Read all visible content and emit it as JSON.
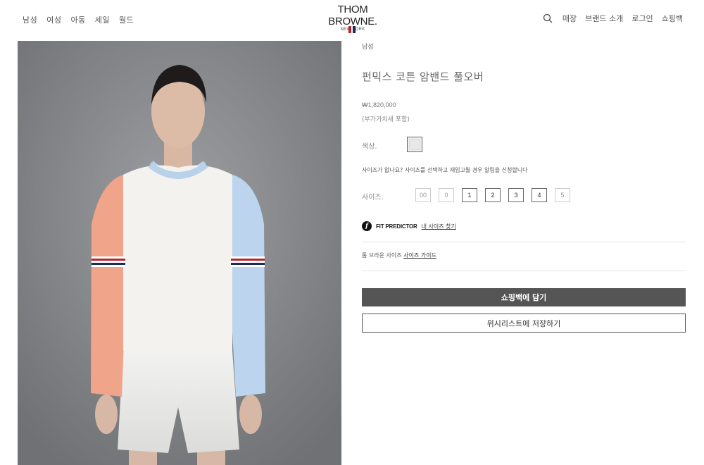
{
  "header": {
    "nav_left": [
      "남성",
      "여성",
      "아동",
      "세일",
      "월드"
    ],
    "logo": {
      "main": "THOM BROWNE.",
      "sub": "NEW YORK"
    },
    "nav_right": {
      "store": "매장",
      "brand": "브랜드 소개",
      "login": "로그인",
      "bag": "쇼핑백"
    }
  },
  "product": {
    "category": "남성",
    "title": "펀믹스 코튼 암밴드 풀오버",
    "price": "₩1,820,000",
    "tax_note": "(부가가치세 포함)",
    "color_label": "색상.",
    "notify_text": "사이즈가 없나요? 사이즈를 선택하고 재입고될 경우 알림을 신청합니다",
    "size_label": "사이즈.",
    "sizes": [
      {
        "label": "00",
        "available": false
      },
      {
        "label": "0",
        "available": false
      },
      {
        "label": "1",
        "available": true
      },
      {
        "label": "2",
        "available": true
      },
      {
        "label": "3",
        "available": true
      },
      {
        "label": "4",
        "available": true
      },
      {
        "label": "5",
        "available": false
      }
    ],
    "fit_predictor_label": "FIT PREDICTOR",
    "fit_predictor_link": "내 사이즈 찾기",
    "size_guide_prefix": "톰 브라운 사이즈",
    "size_guide_link": "사이즈 가이드",
    "add_to_bag": "쇼핑백에 담기",
    "add_to_wishlist": "위시리스트에 저장하기"
  },
  "colors": {
    "primary_button": "#555555",
    "flag_red": "#b3262d",
    "flag_blue": "#1d2a5c"
  },
  "icons": {
    "search": "search-icon",
    "fit": "fit-predictor-icon"
  }
}
